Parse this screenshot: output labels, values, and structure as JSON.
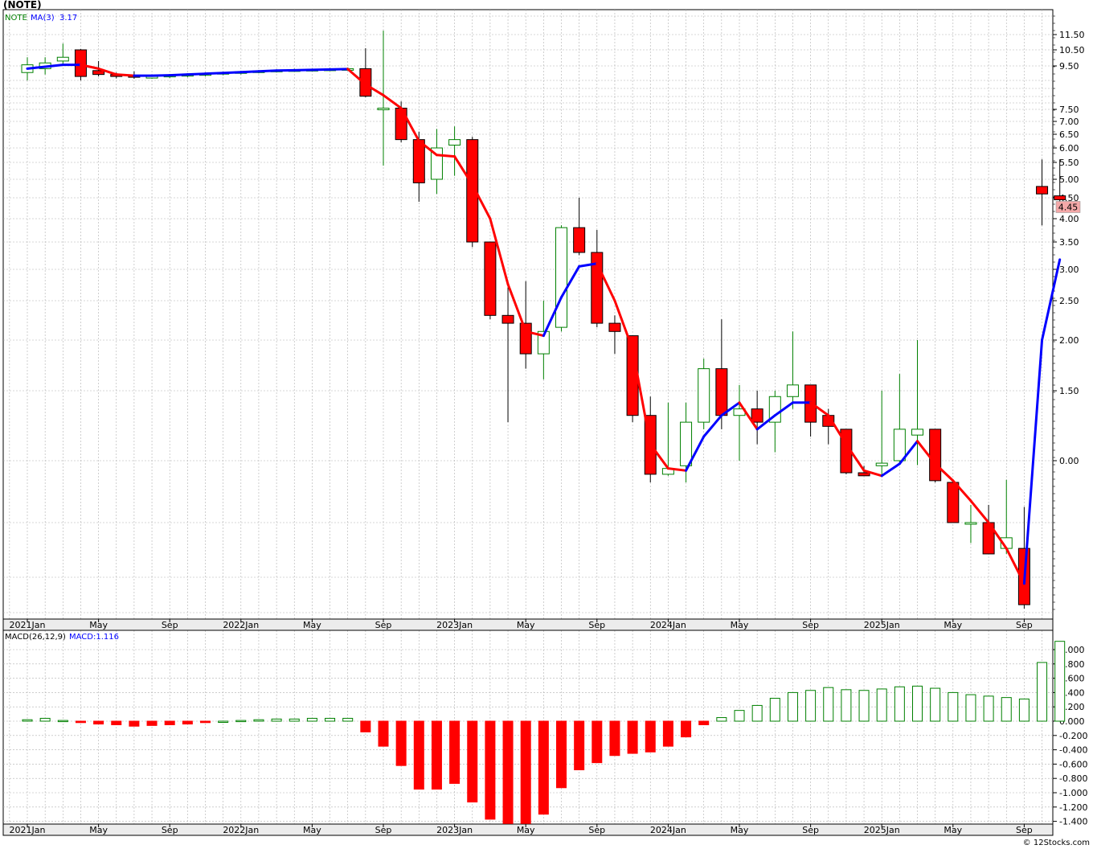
{
  "header": {
    "title": "(NOTE)"
  },
  "legend": {
    "symbol": "NOTE",
    "ma_label": "MA(3)",
    "ma_value": "3.17",
    "macd_label": "MACD(26,12,9)",
    "macd_value_label": "MACD:1.116"
  },
  "watermark": "© 12Stocks.com",
  "colors": {
    "up": "#008000",
    "down": "#ff0000",
    "ma_up": "#0000ff",
    "ma_down": "#ff0000",
    "grid": "#b0b0b0",
    "axis_bg": "#ececec",
    "last_price_bg": "#f4a8a8"
  },
  "chart_data": [
    {
      "type": "candlestick",
      "scale": "log",
      "last_price_label": "4.45",
      "x_tick_labels": [
        "2021Jan",
        "May",
        "Sep",
        "2022Jan",
        "May",
        "Sep",
        "2023Jan",
        "May",
        "Sep",
        "2024Jan",
        "May",
        "Sep",
        "2025Jan",
        "May",
        "Sep"
      ],
      "y_tick_labels": [
        "11.50",
        "10.50",
        "9.50",
        "7.50",
        "7.00",
        "6.50",
        "6.00",
        "5.50",
        "5.00",
        "4.50",
        "4.00",
        "3.50",
        "3.00",
        "2.50",
        "2.00",
        "1.50",
        "0.00"
      ],
      "candles": [
        {
          "date": "2021-01",
          "open": 9.9,
          "high": 10.3,
          "low": 9.7,
          "close": 10.1
        },
        {
          "date": "2021-02",
          "open": 10.0,
          "high": 10.3,
          "low": 9.85,
          "close": 10.15
        },
        {
          "date": "2021-03",
          "open": 10.2,
          "high": 10.9,
          "low": 10.1,
          "close": 10.3
        },
        {
          "date": "2021-04",
          "open": 10.5,
          "high": 10.55,
          "low": 9.7,
          "close": 9.8
        },
        {
          "date": "2021-05",
          "open": 9.95,
          "high": 10.2,
          "low": 9.8,
          "close": 9.85
        },
        {
          "date": "2021-06",
          "open": 9.85,
          "high": 9.9,
          "low": 9.75,
          "close": 9.8
        },
        {
          "date": "2021-07",
          "open": 9.82,
          "high": 9.93,
          "low": 9.74,
          "close": 9.78
        },
        {
          "date": "2021-08",
          "open": 9.78,
          "high": 9.85,
          "low": 9.74,
          "close": 9.8
        },
        {
          "date": "2021-09",
          "open": 9.8,
          "high": 9.86,
          "low": 9.76,
          "close": 9.83
        },
        {
          "date": "2021-10",
          "open": 9.83,
          "high": 9.88,
          "low": 9.78,
          "close": 9.85
        },
        {
          "date": "2021-11",
          "open": 9.85,
          "high": 9.9,
          "low": 9.8,
          "close": 9.87
        },
        {
          "date": "2021-12",
          "open": 9.87,
          "high": 9.92,
          "low": 9.83,
          "close": 9.9
        },
        {
          "date": "2022-01",
          "open": 9.9,
          "high": 9.94,
          "low": 9.85,
          "close": 9.92
        },
        {
          "date": "2022-02",
          "open": 9.92,
          "high": 9.96,
          "low": 9.88,
          "close": 9.94
        },
        {
          "date": "2022-03",
          "open": 9.94,
          "high": 9.98,
          "low": 9.9,
          "close": 9.96
        },
        {
          "date": "2022-04",
          "open": 9.96,
          "high": 10.0,
          "low": 9.92,
          "close": 9.97
        },
        {
          "date": "2022-05",
          "open": 9.97,
          "high": 10.0,
          "low": 9.93,
          "close": 9.98
        },
        {
          "date": "2022-06",
          "open": 9.98,
          "high": 10.02,
          "low": 9.94,
          "close": 9.99
        },
        {
          "date": "2022-07",
          "open": 9.99,
          "high": 10.03,
          "low": 9.95,
          "close": 10.0
        },
        {
          "date": "2022-08",
          "open": 10.0,
          "high": 10.6,
          "low": 8.6,
          "close": 8.7
        },
        {
          "date": "2022-09",
          "open": 7.5,
          "high": 11.8,
          "low": 5.4,
          "close": 7.6
        },
        {
          "date": "2022-10",
          "open": 7.6,
          "high": 8.2,
          "low": 6.2,
          "close": 6.3
        },
        {
          "date": "2022-11",
          "open": 6.3,
          "high": 6.6,
          "low": 4.4,
          "close": 4.9
        },
        {
          "date": "2022-12",
          "open": 5.0,
          "high": 6.7,
          "low": 4.6,
          "close": 6.0
        },
        {
          "date": "2023-01",
          "open": 6.1,
          "high": 6.8,
          "low": 5.1,
          "close": 6.3
        },
        {
          "date": "2023-02",
          "open": 6.3,
          "high": 6.4,
          "low": 3.4,
          "close": 3.5
        },
        {
          "date": "2023-03",
          "open": 3.5,
          "high": 3.5,
          "low": 2.25,
          "close": 2.3
        },
        {
          "date": "2023-04",
          "open": 2.3,
          "high": 2.7,
          "low": 1.25,
          "close": 2.2
        },
        {
          "date": "2023-05",
          "open": 2.2,
          "high": 2.8,
          "low": 1.7,
          "close": 1.85
        },
        {
          "date": "2023-06",
          "open": 1.85,
          "high": 2.5,
          "low": 1.6,
          "close": 2.1
        },
        {
          "date": "2023-07",
          "open": 2.15,
          "high": 3.85,
          "low": 2.1,
          "close": 3.8
        },
        {
          "date": "2023-08",
          "open": 3.8,
          "high": 4.5,
          "low": 3.25,
          "close": 3.3
        },
        {
          "date": "2023-09",
          "open": 3.3,
          "high": 3.75,
          "low": 2.15,
          "close": 2.2
        },
        {
          "date": "2023-10",
          "open": 2.2,
          "high": 2.3,
          "low": 1.85,
          "close": 2.1
        },
        {
          "date": "2023-11",
          "open": 2.05,
          "high": 2.05,
          "low": 1.25,
          "close": 1.3
        },
        {
          "date": "2023-12",
          "open": 1.3,
          "high": 1.45,
          "low": 0.7,
          "close": 0.8
        },
        {
          "date": "2024-01",
          "open": 0.8,
          "high": 1.4,
          "low": 0.78,
          "close": 0.88
        },
        {
          "date": "2024-02",
          "open": 0.92,
          "high": 1.4,
          "low": 0.7,
          "close": 1.25
        },
        {
          "date": "2024-03",
          "open": 1.25,
          "high": 1.8,
          "low": 1.2,
          "close": 1.7
        },
        {
          "date": "2024-04",
          "open": 1.7,
          "high": 2.25,
          "low": 1.2,
          "close": 1.3
        },
        {
          "date": "2024-05",
          "open": 1.3,
          "high": 1.55,
          "low": 1.0,
          "close": 1.35
        },
        {
          "date": "2024-06",
          "open": 1.35,
          "high": 1.5,
          "low": 1.1,
          "close": 1.25
        },
        {
          "date": "2024-07",
          "open": 1.25,
          "high": 1.5,
          "low": 1.05,
          "close": 1.45
        },
        {
          "date": "2024-08",
          "open": 1.45,
          "high": 2.1,
          "low": 1.35,
          "close": 1.55
        },
        {
          "date": "2024-09",
          "open": 1.55,
          "high": 1.55,
          "low": 1.15,
          "close": 1.25
        },
        {
          "date": "2024-10",
          "open": 1.3,
          "high": 1.35,
          "low": 1.1,
          "close": 1.22
        },
        {
          "date": "2024-11",
          "open": 1.2,
          "high": 1.2,
          "low": 0.8,
          "close": 0.82
        },
        {
          "date": "2024-12",
          "open": 0.82,
          "high": 0.92,
          "low": 0.79,
          "close": 0.78
        },
        {
          "date": "2025-01",
          "open": 0.92,
          "high": 1.5,
          "low": 0.78,
          "close": 0.96
        },
        {
          "date": "2025-02",
          "open": 1.0,
          "high": 1.65,
          "low": 0.93,
          "close": 1.2
        },
        {
          "date": "2025-03",
          "open": 1.16,
          "high": 2.0,
          "low": 0.93,
          "close": 1.2
        },
        {
          "date": "2025-04",
          "open": 1.2,
          "high": 1.2,
          "low": 0.7,
          "close": 0.72
        },
        {
          "date": "2025-05",
          "open": 0.7,
          "high": 0.7,
          "low": 0.5,
          "close": 0.5
        },
        {
          "date": "2025-06",
          "open": 0.5,
          "high": 0.58,
          "low": 0.46,
          "close": 0.5
        },
        {
          "date": "2025-07",
          "open": 0.5,
          "high": 0.58,
          "low": 0.45,
          "close": 0.44
        },
        {
          "date": "2025-08",
          "open": 0.45,
          "high": 0.73,
          "low": 0.44,
          "close": 0.47
        },
        {
          "date": "2025-09",
          "open": 0.45,
          "high": 0.57,
          "low": 0.31,
          "close": 0.32
        },
        {
          "date": "2025-10",
          "open": 4.8,
          "high": 5.6,
          "low": 3.85,
          "close": 4.6
        },
        {
          "date": "2025-11",
          "open": 4.55,
          "high": 5.6,
          "low": 4.2,
          "close": 4.45
        }
      ],
      "ma3": [
        10.0,
        10.05,
        10.1,
        10.1,
        10.0,
        9.85,
        9.82,
        9.82,
        9.83,
        9.85,
        9.87,
        9.89,
        9.91,
        9.93,
        9.95,
        9.96,
        9.97,
        9.98,
        9.99,
        9.6,
        8.8,
        7.6,
        6.25,
        5.75,
        5.7,
        4.85,
        4.0,
        2.75,
        2.1,
        2.05,
        2.55,
        3.05,
        3.1,
        2.5,
        1.9,
        1.1,
        0.88,
        0.85,
        1.15,
        1.3,
        1.4,
        1.2,
        1.3,
        1.4,
        1.4,
        1.3,
        1.1,
        0.85,
        0.78,
        0.95,
        1.12,
        0.95,
        0.72,
        0.6,
        0.5,
        0.45,
        0.38,
        2.0,
        3.17
      ],
      "ma_label": "MA(3)"
    },
    {
      "type": "bar",
      "series_name": "MACD(26,12,9)",
      "y_tick_labels": [
        "1.000",
        "0.800",
        "0.600",
        "0.400",
        "0.200",
        "0.000",
        "-0.200",
        "-0.400",
        "-0.600",
        "-0.800",
        "-1.000",
        "-1.200",
        "-1.400"
      ],
      "ylim": [
        -1.45,
        1.2
      ],
      "values": [
        0.02,
        0.04,
        0.01,
        -0.02,
        -0.04,
        -0.05,
        -0.07,
        -0.06,
        -0.05,
        -0.04,
        -0.02,
        0.0,
        0.01,
        0.02,
        0.03,
        0.03,
        0.04,
        0.04,
        0.04,
        -0.15,
        -0.35,
        -0.62,
        -0.95,
        -0.95,
        -0.87,
        -1.13,
        -1.37,
        -1.43,
        -1.43,
        -1.3,
        -0.93,
        -0.68,
        -0.58,
        -0.48,
        -0.45,
        -0.43,
        -0.35,
        -0.22,
        -0.05,
        0.05,
        0.15,
        0.22,
        0.32,
        0.4,
        0.43,
        0.47,
        0.44,
        0.43,
        0.45,
        0.48,
        0.49,
        0.46,
        0.4,
        0.37,
        0.35,
        0.33,
        0.31,
        0.82,
        1.116
      ]
    }
  ]
}
